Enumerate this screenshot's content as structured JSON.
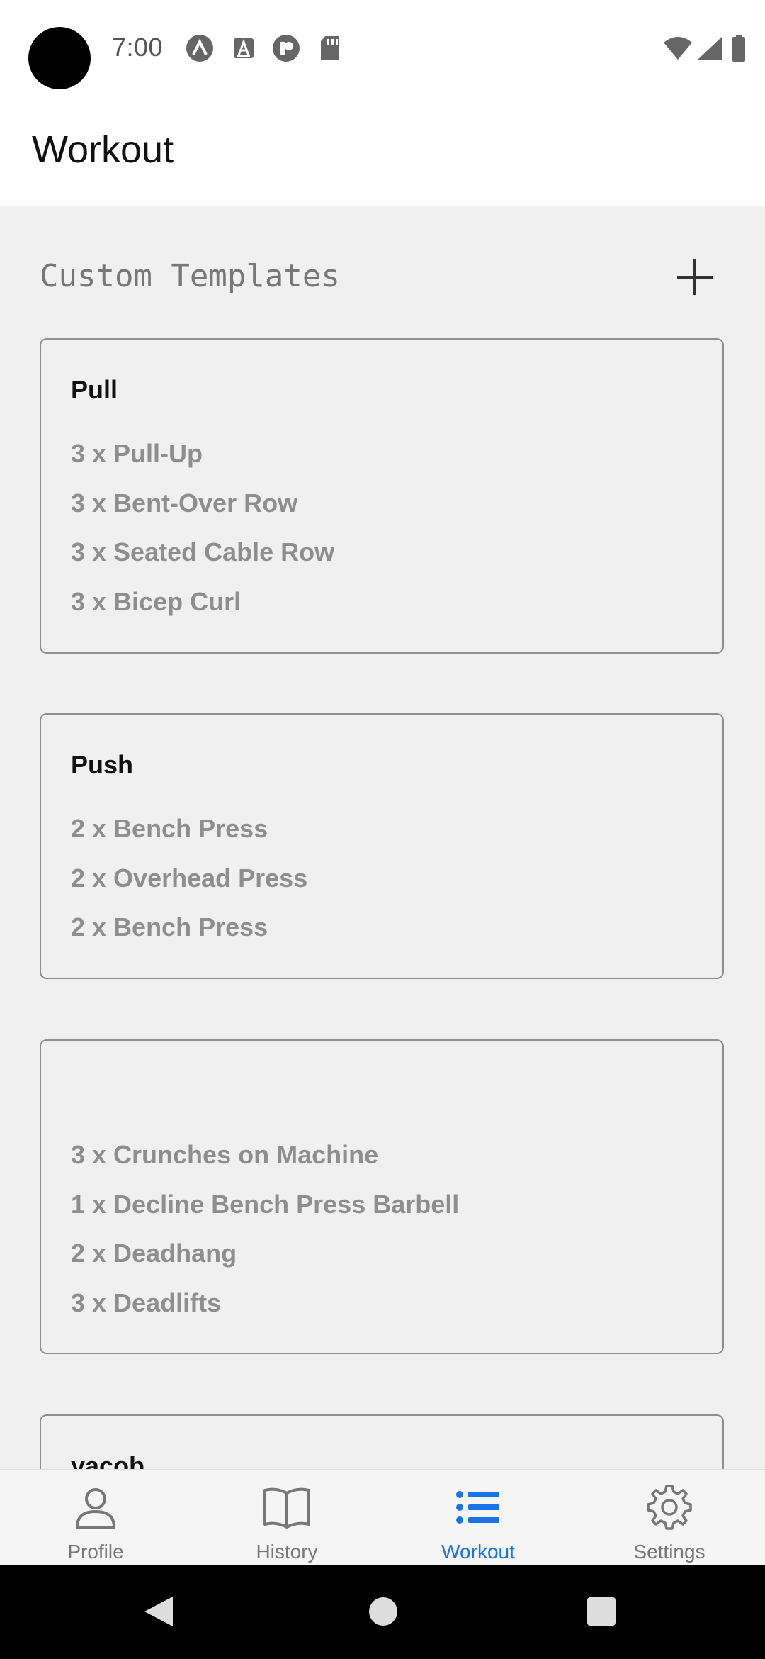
{
  "status_bar": {
    "time": "7:00",
    "left_icons": [
      "a-circle-icon",
      "font-a-icon",
      "p-circle-icon",
      "sd-card-icon"
    ],
    "right_icons": [
      "wifi-icon",
      "signal-icon",
      "battery-icon"
    ]
  },
  "header": {
    "title": "Workout"
  },
  "templates": {
    "section_title": "Custom Templates",
    "add_icon": "plus-icon",
    "cards": [
      {
        "title": "Pull",
        "lines": [
          "3 x Pull-Up",
          "3 x Bent-Over Row",
          "3 x Seated Cable Row",
          "3 x Bicep Curl"
        ]
      },
      {
        "title": "Push",
        "lines": [
          "2 x Bench Press",
          "2 x Overhead Press",
          "2 x Bench Press"
        ]
      },
      {
        "title": "",
        "lines": [
          "3 x Crunches on Machine",
          "1 x Decline Bench Press Barbell",
          "2 x Deadhang",
          "3 x Deadlifts"
        ]
      },
      {
        "title": "yacob",
        "lines": []
      }
    ]
  },
  "bottom_nav": {
    "items": [
      {
        "label": "Profile",
        "icon": "person-icon"
      },
      {
        "label": "History",
        "icon": "book-icon"
      },
      {
        "label": "Workout",
        "icon": "list-icon"
      },
      {
        "label": "Settings",
        "icon": "gear-icon"
      }
    ],
    "active": "Workout",
    "accent_color": "#1a73e8"
  },
  "system_nav": {
    "icons": [
      "back-icon",
      "home-icon",
      "recents-icon"
    ]
  }
}
